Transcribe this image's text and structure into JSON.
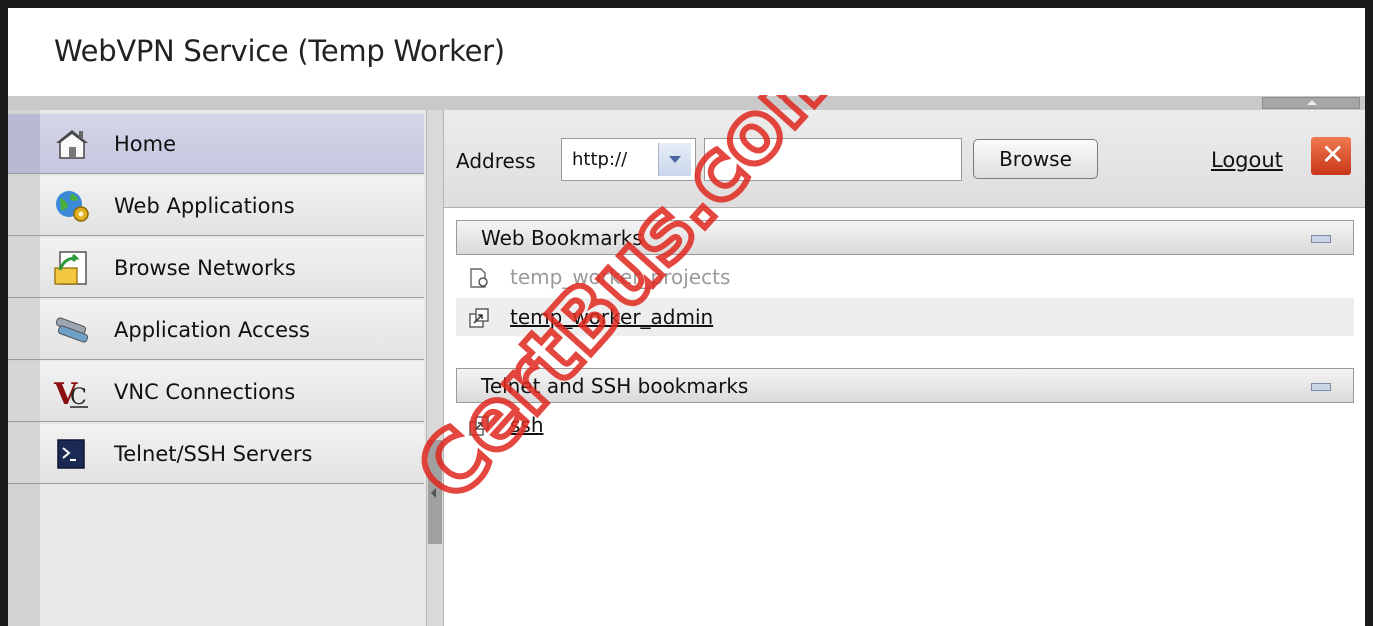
{
  "window": {
    "title": "WebVPN Service (Temp Worker)"
  },
  "sidebar": {
    "items": [
      {
        "label": "Home",
        "icon": "home-icon",
        "active": true
      },
      {
        "label": "Web Applications",
        "icon": "web-applications-icon"
      },
      {
        "label": "Browse Networks",
        "icon": "browse-networks-icon"
      },
      {
        "label": "Application Access",
        "icon": "application-access-icon"
      },
      {
        "label": "VNC Connections",
        "icon": "vnc-icon"
      },
      {
        "label": "Telnet/SSH Servers",
        "icon": "terminal-icon"
      }
    ]
  },
  "toolbar": {
    "address_label": "Address",
    "protocol_value": "http://",
    "url_value": "",
    "browse_label": "Browse",
    "logout_label": "Logout"
  },
  "sections": {
    "web_bookmarks": {
      "title": "Web Bookmarks",
      "items": [
        {
          "label": "temp_worker_projects",
          "enabled": false
        },
        {
          "label": "temp_worker_admin",
          "enabled": true
        }
      ]
    },
    "telnet_bookmarks": {
      "title": "Telnet and SSH bookmarks",
      "items": [
        {
          "label": "ssh",
          "enabled": true
        }
      ]
    }
  },
  "watermark": "CertBus.com",
  "colors": {
    "active_item": "#c6c7df",
    "close_button": "#d9462a",
    "watermark": "#e0281e"
  }
}
